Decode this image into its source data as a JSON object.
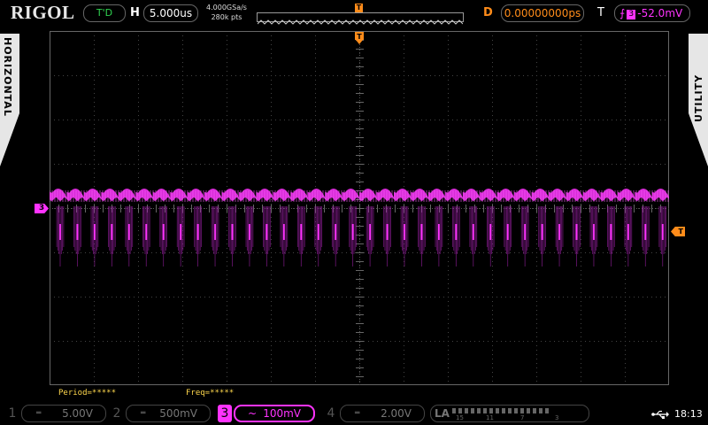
{
  "brand": "RIGOL",
  "run_state": "T'D",
  "horizontal": {
    "letter": "H",
    "timebase": "5.000us",
    "sample_rate": "4.000GSa/s",
    "memory_depth": "280k pts"
  },
  "memory_trigger_marker": "T",
  "delay": {
    "letter": "D",
    "value": "0.00000000ps"
  },
  "trigger": {
    "letter": "T",
    "edge_symbol": "⨍",
    "source": "3",
    "level": "-52.0mV"
  },
  "side_tabs": {
    "left": "HORIZONTAL",
    "right": "UTILITY"
  },
  "markers": {
    "trigger_top": "T",
    "channel_ref": "3",
    "trigger_level": "T"
  },
  "measurements": {
    "period": "Period=*****",
    "freq": "Freq=*****"
  },
  "channels": [
    {
      "num": "1",
      "coupling": "═",
      "scale": "5.00V"
    },
    {
      "num": "2",
      "coupling": "═",
      "scale": "500mV"
    },
    {
      "num": "3",
      "coupling": "~",
      "scale": "100mV"
    },
    {
      "num": "4",
      "coupling": "═",
      "scale": "2.00V"
    }
  ],
  "la": {
    "label": "LA",
    "groups": [
      "15",
      "11",
      "7",
      "3"
    ]
  },
  "clock": "18:13",
  "colors": {
    "ch3": "#ff33ff",
    "trigger": "#ff8c1a",
    "run": "#2fd14f",
    "measure": "#ffd84d"
  }
}
